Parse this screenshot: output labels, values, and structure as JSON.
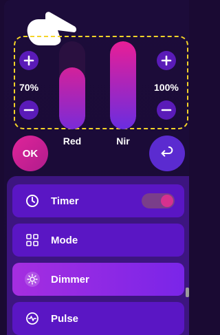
{
  "channels": {
    "red": {
      "label": "Red",
      "percent_text": "70%",
      "level": 0.7
    },
    "nir": {
      "label": "Nir",
      "percent_text": "100%",
      "level": 1.0
    }
  },
  "buttons": {
    "ok_label": "OK"
  },
  "menu": {
    "items": [
      {
        "label": "Timer",
        "icon": "clock-icon",
        "toggle_on": true
      },
      {
        "label": "Mode",
        "icon": "grid-icon"
      },
      {
        "label": "Dimmer",
        "icon": "sun-icon",
        "active": true
      },
      {
        "label": "Pulse",
        "icon": "pulse-icon"
      }
    ]
  },
  "colors": {
    "background": "#1a0a33",
    "accent": "#e0249a",
    "button": "#5a1bb8",
    "selection": "#f5d428"
  }
}
